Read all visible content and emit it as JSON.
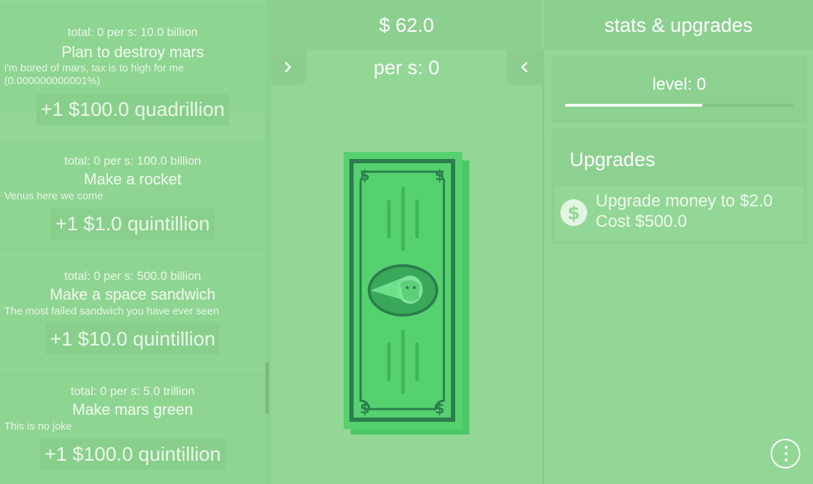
{
  "left_panel": {
    "items": [
      {
        "stats": "total: 0 per s: 10.0 billion",
        "title": "Plan to destroy mars",
        "desc": "i'm bored of mars, tax is to high for me (0.000000000001%)",
        "buy": "+1 $100.0 quadrillion"
      },
      {
        "stats": "total: 0 per s: 100.0 billion",
        "title": "Make a rocket",
        "desc": "Venus here we come",
        "buy": "+1 $1.0 quintillion"
      },
      {
        "stats": "total: 0 per s: 500.0 billion",
        "title": "Make a space sandwich",
        "desc": "The most failed sandwich you have ever seen",
        "buy": "+1 $10.0 quintillion"
      },
      {
        "stats": "total: 0 per s: 5.0 trillion",
        "title": "Make mars green",
        "desc": "This is no joke",
        "buy": "+1 $100.0 quintillion"
      }
    ]
  },
  "center": {
    "money": "$ 62.0",
    "per_sec": "per s: 0",
    "nav_left_icon": "chevron-right-icon",
    "nav_right_icon": "chevron-left-icon",
    "bill_icon": "dollar-bill-icon"
  },
  "right_panel": {
    "title": "stats & upgrades",
    "level": "level: 0",
    "level_progress": 0.6,
    "upgrades_title": "Upgrades",
    "upgrades": [
      {
        "name": "Upgrade money to $2.0",
        "cost": "Cost $500.0",
        "icon": "dollar-coin-icon"
      }
    ],
    "menu_icon": "more-vertical-icon"
  },
  "colors": {
    "background": "#93d796",
    "bill_dark": "#2a7a4a",
    "bill_light": "#52cf6a",
    "text": "#ffffff"
  }
}
